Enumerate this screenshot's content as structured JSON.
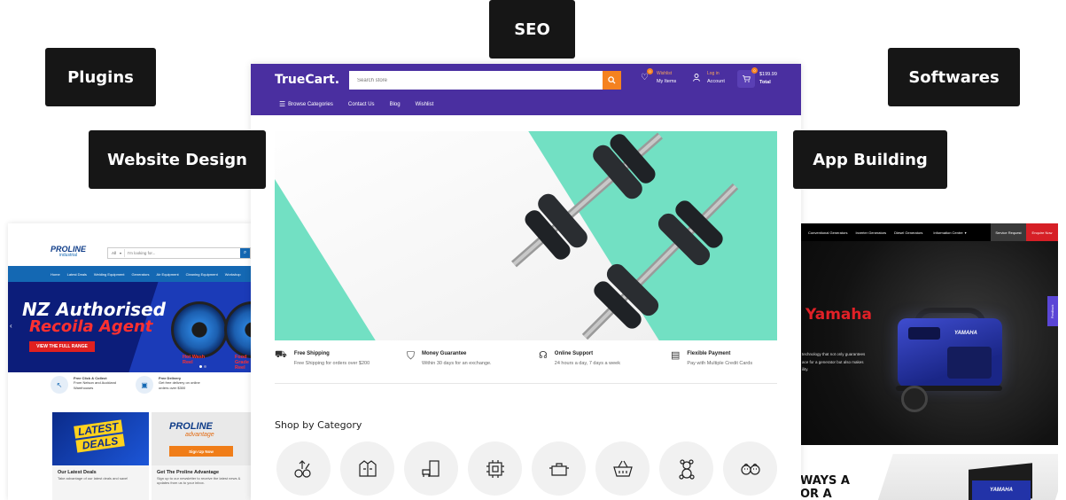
{
  "tags": {
    "seo": "SEO",
    "plugins": "Plugins",
    "softwares": "Softwares",
    "website_design": "Website Design",
    "app_building": "App Building"
  },
  "left_site": {
    "logo": "PROLINE",
    "logo_sub": "industrial",
    "search_filter": "All",
    "search_placeholder": "I'm looking for...",
    "nav": [
      "Home",
      "Latest Deals",
      "Welding Equipment",
      "Generators",
      "Air Equipment",
      "Cleaning Equipment",
      "Workshop"
    ],
    "hero_line1": "NZ Authorised",
    "hero_line2": "Recoila Agent",
    "hero_button": "VIEW THE FULL RANGE",
    "hero_badge1": "Hot Wash Reel",
    "hero_badge2": "Food Grade Reel",
    "features": [
      {
        "title": "Free Click & Collect",
        "text": "From Nelson and Auckland Warehouses"
      },
      {
        "title": "Free Delivery",
        "text": "Get free delivery on online orders over $300"
      }
    ],
    "promo1": {
      "badge_line1": "LATEST",
      "badge_line2": "DEALS",
      "title": "Our Latest Deals",
      "text": "Take advantage of our latest deals and save!"
    },
    "promo2": {
      "logo": "PROLINE",
      "logo_sub": "advantage",
      "button": "Sign Up Now",
      "title": "Get The Proline Advantage",
      "text": "Sign up to our newsletter to receive the latest news & updates from us to your inbox."
    }
  },
  "right_site": {
    "nav": [
      "Conventional Generators",
      "Inverter Generators",
      "Diesel Generators",
      "Information Centre"
    ],
    "service_button": "Service Request",
    "enquire_button": "Enquire Now",
    "feedback_tab": "Feedback",
    "hero_title": "Yamaha",
    "hero_text": [
      "technology that not only guarantees",
      "ace for a generator but also makes",
      "ility."
    ],
    "bottom_line1": "WAYS A",
    "bottom_line2": "OR A",
    "product_brand": "YAMAHA"
  },
  "truecart": {
    "logo": "TrueCart.",
    "search_placeholder": "Search store",
    "wishlist_count": "0",
    "wishlist_label": "Wishlist",
    "wishlist_sub": "My Items",
    "account_label": "Log in",
    "account_sub": "Account",
    "cart_count": "0",
    "cart_total": "$199.99",
    "cart_sub": "Total",
    "nav": {
      "browse": "Browse Categories",
      "contact": "Contact Us",
      "blog": "Blog",
      "wishlist": "Wishlist"
    },
    "features": [
      {
        "title": "Free Shipping",
        "text": "Free Shipping for orders over $200"
      },
      {
        "title": "Money Guarantee",
        "text": "Within 30 days for an exchange."
      },
      {
        "title": "Online Support",
        "text": "24 hours a day, 7 days a week"
      },
      {
        "title": "Flexible Payment",
        "text": "Pay with Multiple Credit Cards"
      }
    ],
    "shop_title": "Shop by Category",
    "categories": [
      "groceries-icon",
      "jacket-icon",
      "furniture-icon",
      "chip-icon",
      "cooking-pot-icon",
      "basket-icon",
      "teddy-bear-icon",
      "baby-icon"
    ]
  },
  "colors": {
    "truecart_purple": "#4a2fa0",
    "truecart_orange": "#f58220",
    "proline_blue": "#1468b3",
    "yamaha_red": "#d61f26",
    "tag_bg": "#161616"
  }
}
